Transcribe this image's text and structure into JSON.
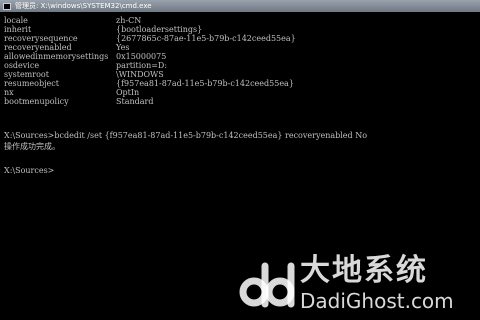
{
  "window": {
    "title": "管理员: X:\\windows\\SYSTEM32\\cmd.exe"
  },
  "console": {
    "entries": [
      {
        "key": "locale",
        "value": "zh-CN"
      },
      {
        "key": "inherit",
        "value": "{bootloadersettings}"
      },
      {
        "key": "recoverysequence",
        "value": "{2677865c-87ae-11e5-b79b-c142ceed55ea}"
      },
      {
        "key": "recoveryenabled",
        "value": "Yes"
      },
      {
        "key": "allowedinmemorysettings",
        "value": "0x15000075"
      },
      {
        "key": "osdevice",
        "value": "partition=D:"
      },
      {
        "key": "systemroot",
        "value": "\\WINDOWS"
      },
      {
        "key": "resumeobject",
        "value": "{f957ea81-87ad-11e5-b79b-c142ceed55ea}"
      },
      {
        "key": "nx",
        "value": "OptIn"
      },
      {
        "key": "bootmenupolicy",
        "value": "Standard"
      }
    ],
    "command_line": "X:\\Sources>bcdedit /set {f957ea81-87ad-11e5-b79b-c142ceed55ea} recoveryenabled No",
    "result_line": "操作成功完成。",
    "prompt_line": "X:\\Sources>"
  },
  "watermark": {
    "cn_text": "大地系统",
    "en_text": "DadiGhost.com"
  }
}
